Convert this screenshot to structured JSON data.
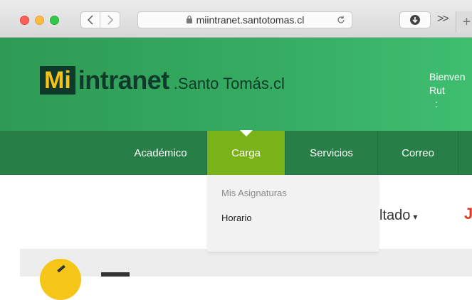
{
  "browser": {
    "url": "miintranet.santotomas.cl",
    "back_icon": "chevron-left-icon",
    "forward_icon": "chevron-right-icon",
    "lock_icon": "lock-icon",
    "reload_icon": "reload-icon",
    "download_icon": "download-icon",
    "more_label": ">>",
    "new_tab_label": "+"
  },
  "header": {
    "logo_mi": "Mi",
    "logo_intranet": "intranet",
    "logo_suffix": ".Santo Tomás.cl",
    "welcome_line1": "Bienven",
    "welcome_line2": "Rut",
    "welcome_line3": ":"
  },
  "nav": {
    "items": [
      {
        "label": "Académico",
        "active": false
      },
      {
        "label": "Carga",
        "active": true
      },
      {
        "label": "Servicios",
        "active": false
      },
      {
        "label": "Correo",
        "active": false
      }
    ]
  },
  "dropdown": {
    "section_label": "Mis Asignaturas",
    "items": [
      "Horario"
    ]
  },
  "content": {
    "resultado_label": "ltado",
    "resultado_caret": "▾",
    "red_glyph": "J"
  },
  "colors": {
    "header_green": "#36ad63",
    "nav_green": "#277f47",
    "active_green": "#7ab317",
    "logo_dark": "#0f3a2a",
    "logo_yellow": "#f6c21c"
  }
}
